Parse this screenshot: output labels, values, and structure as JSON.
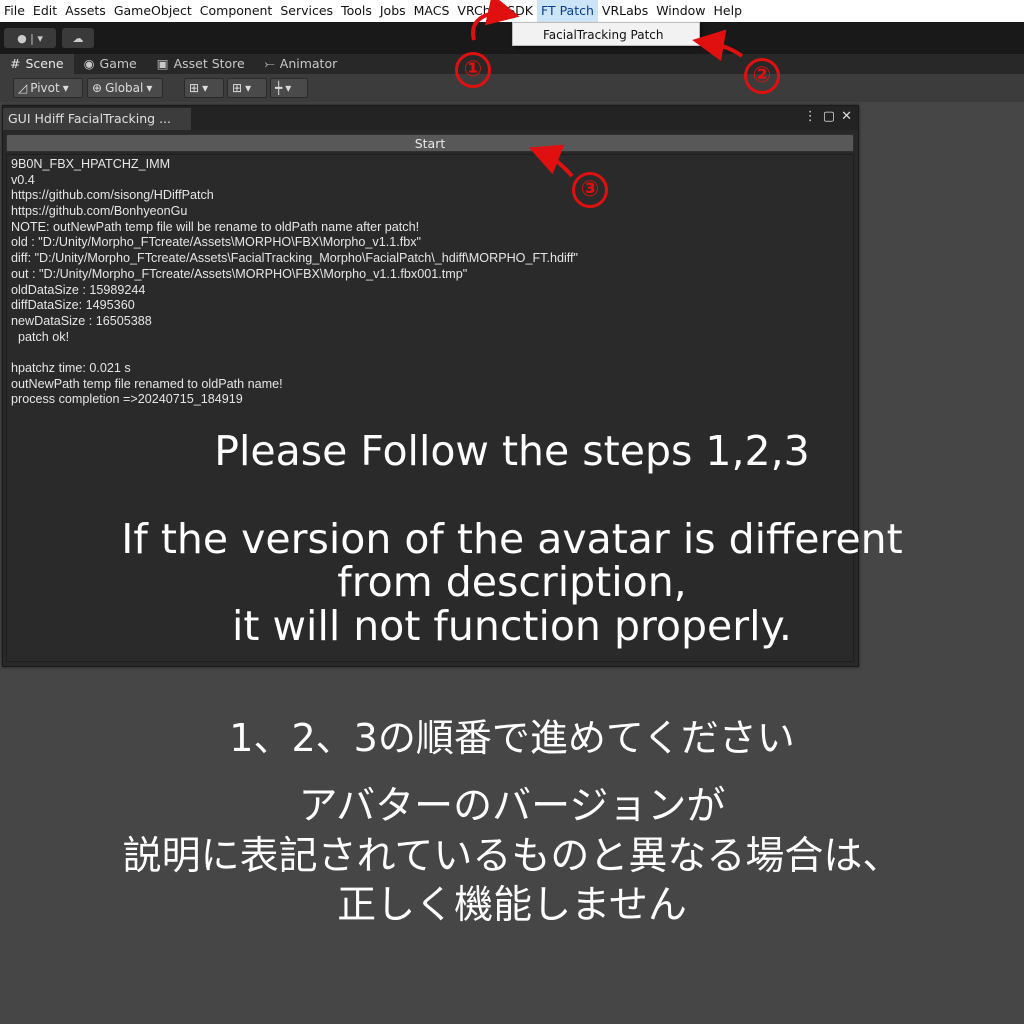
{
  "menubar": {
    "items": [
      "File",
      "Edit",
      "Assets",
      "GameObject",
      "Component",
      "Services",
      "Tools",
      "Jobs",
      "MACS",
      "VRChat SDK",
      "FT Patch",
      "VRLabs",
      "Window",
      "Help"
    ],
    "active_index": 10
  },
  "dropdown": {
    "item": "FacialTracking Patch"
  },
  "tabs": [
    "Scene",
    "Game",
    "Asset Store",
    "Animator"
  ],
  "scene_toolbar": {
    "pivot": "Pivot",
    "global": "Global"
  },
  "window": {
    "tab_title": "GUI Hdiff FacialTracking ...",
    "start_label": "Start",
    "log_lines": [
      "9B0N_FBX_HPATCHZ_IMM",
      "v0.4",
      "https://github.com/sisong/HDiffPatch",
      "https://github.com/BonhyeonGu",
      "NOTE: outNewPath temp file will be rename to oldPath name after patch!",
      "old : \"D:/Unity/Morpho_FTcreate/Assets\\MORPHO\\FBX\\Morpho_v1.1.fbx\"",
      "diff: \"D:/Unity/Morpho_FTcreate/Assets\\FacialTracking_Morpho\\FacialPatch\\_hdiff\\MORPHO_FT.hdiff\"",
      "out : \"D:/Unity/Morpho_FTcreate/Assets\\MORPHO\\FBX\\Morpho_v1.1.fbx001.tmp\"",
      "oldDataSize : 15989244",
      "diffDataSize: 1495360",
      "newDataSize : 16505388",
      "  patch ok!",
      "",
      "hpatchz time: 0.021 s",
      "outNewPath temp file renamed to oldPath name!",
      "process completion =>20240715_184919"
    ]
  },
  "overlay": {
    "en_line1": "Please Follow the steps 1,2,3",
    "en_line2": "If the version of the avatar is different",
    "en_line3": "from description,",
    "en_line4": " it will not function properly.",
    "jp_line1": "1、2、3の順番で進めてください",
    "jp_line2": "アバターのバージョンが",
    "jp_line3": "説明に表記されているものと異なる場合は、",
    "jp_line4": "正しく機能しません"
  },
  "badges": [
    "①",
    "②",
    "③"
  ],
  "colors": {
    "annotation": "#e01010",
    "menu_active_bg": "#cce4f7"
  },
  "icons": [
    "account-icon",
    "cloud-icon",
    "game-icon",
    "asset-store-icon",
    "animator-icon",
    "pivot-icon",
    "global-icon",
    "grid-snap-icon",
    "increment-snap-icon",
    "ruler-icon",
    "kebab-menu-icon",
    "maximize-icon",
    "close-icon"
  ]
}
